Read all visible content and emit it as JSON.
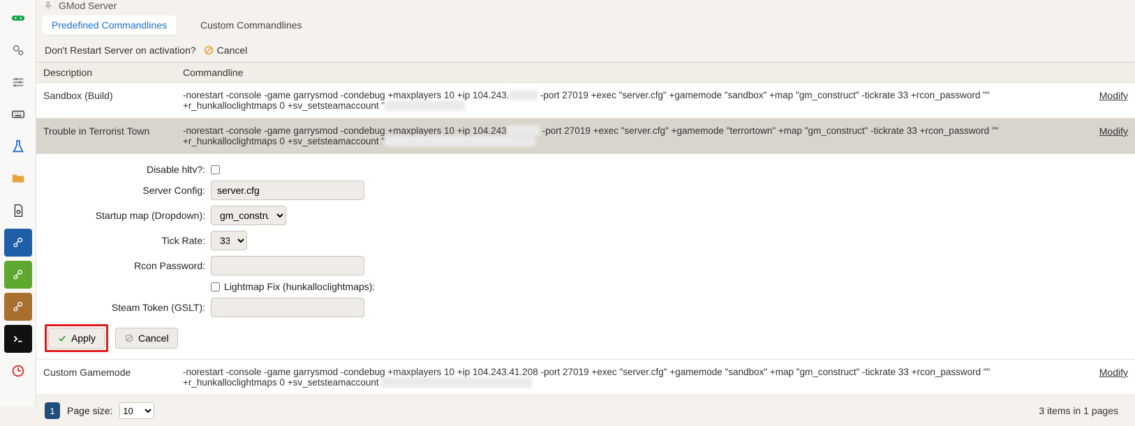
{
  "title": "GMod Server",
  "tabs": {
    "predefined": "Predefined Commandlines",
    "custom": "Custom Commandlines"
  },
  "restart_bar": {
    "prompt": "Don't Restart Server on activation?",
    "cancel": "Cancel"
  },
  "table": {
    "header_desc": "Description",
    "header_cmd": "Commandline",
    "modify": "Modify",
    "rows": [
      {
        "desc": "Sandbox (Build)",
        "cmd_pre": "-norestart -console -game garrysmod -condebug +maxplayers 10 +ip 104.243.",
        "cmd_mask1": "xxxxxx",
        "cmd_mid": "-port 27019 +exec \"server.cfg\" +gamemode \"sandbox\" +map \"gm_construct\" -tickrate 33 +rcon_password \"\" +r_hunkalloclightmaps 0 +sv_setsteamaccount \"",
        "cmd_mask2": "xxxxxxxxxxxxxxxxx"
      },
      {
        "desc": "Trouble in Terrorist Town",
        "cmd_pre": "-norestart -console -game garrysmod -condebug +maxplayers 10 +ip 104.243",
        "cmd_mask1": "xxxxxxx",
        "cmd_mid": "-port 27019 +exec \"server.cfg\" +gamemode \"terrortown\" +map \"gm_construct\" -tickrate 33 +rcon_password \"\" +r_hunkalloclightmaps 0 +sv_setsteamaccount \"",
        "cmd_mask2": "xxxxxxxxxxxxxxxxxxxxxxxxxxxxxxxx"
      },
      {
        "desc": "Custom Gamemode",
        "cmd_pre": "-norestart -console -game garrysmod -condebug +maxplayers 10 +ip 104.243.41.208 -port 27019 +exec \"server.cfg\" +gamemode \"sandbox\" +map \"gm_construct\" -tickrate 33 +rcon_password \"\" +r_hunkalloclightmaps 0 +sv_setsteamaccount",
        "cmd_mask1": "xxxxxxxxxxxxxxxxxxxxxxxxxxxxxxxx",
        "cmd_mid": "",
        "cmd_mask2": ""
      }
    ]
  },
  "form": {
    "labels": {
      "hltv": "Disable hltv?:",
      "server_config": "Server Config:",
      "startup_map": "Startup map (Dropdown):",
      "tickrate": "Tick Rate:",
      "rcon": "Rcon Password:",
      "lightmap": "Lightmap Fix (hunkalloclightmaps):",
      "gslt": "Steam Token (GSLT):"
    },
    "values": {
      "server_config": "server.cfg",
      "startup_map": "gm_construct",
      "tickrate": "33",
      "rcon": "",
      "gslt": ""
    },
    "apply": "Apply",
    "cancel": "Cancel"
  },
  "pager": {
    "current": "1",
    "page_size_label": "Page size:",
    "page_size": "10",
    "summary": "3 items in 1 pages"
  },
  "icons": {
    "controller": "controller-icon",
    "gears": "gears-icon",
    "sliders": "sliders-icon",
    "keyboard": "keyboard-icon",
    "flask": "flask-icon",
    "folder": "folder-icon",
    "file": "file-icon",
    "steam1": "steam-icon",
    "steam2": "steam-workshop-icon",
    "steam3": "steam-mod-icon",
    "terminal": "terminal-icon",
    "clock": "clock-icon"
  }
}
